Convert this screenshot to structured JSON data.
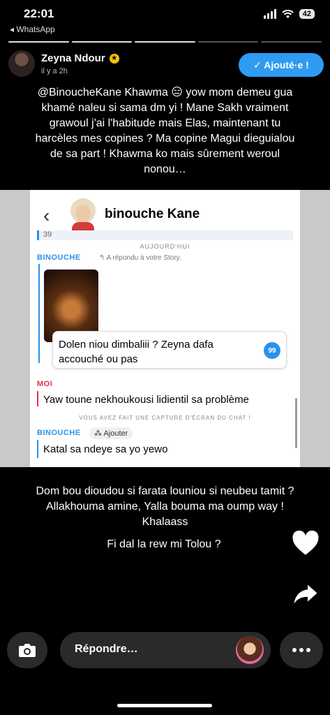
{
  "status": {
    "time": "22:01",
    "back_app": "◂ WhatsApp",
    "battery": "42"
  },
  "story": {
    "username": "Zeyna Ndour",
    "time_ago": "il y a 2h",
    "added_button": "✓ Ajouté·e !",
    "caption": "@BinoucheKane Khawma 😑 yow mom demeu gua\nkhamé naleu si sama dm yi ! Mane Sakh vraiment\ngrawoul j'ai l'habitude mais Elas, maintenant tu\nharcèles mes copines ? Ma copine Magui dieguialou\nde sa part ! Khawma ko mais sûrement weroul\nnonou…"
  },
  "chat": {
    "title": "binouche Kane",
    "prev_fragment": "39",
    "date_label": "AUJOURD'HUI",
    "sender_binouche": "BINOUCHE",
    "reply_note": "↰ A répondu à votre Story.",
    "reply_text": "Dolen niou dimbaliii ? Zeyna dafa\naccouché ou pas",
    "reply_badge": "99",
    "sender_moi": "MOI",
    "moi_text": "Yaw toune nekhoukousi lidientil sa problème",
    "capture_note": "VOUS AVEZ FAIT UNE CAPTURE D'ÉCRAN DU CHAT !",
    "sender_binouche2": "BINOUCHE",
    "add_chip": "⁂ Ajouter",
    "last_text": "Katal sa ndeye sa yo yewo"
  },
  "body": {
    "text1": "Dom bou dioudou si farata louniou si neubeu tamit ?\nAllakhouma amine, Yalla bouma ma oump way !\nKhalaass",
    "text2": "Fi dal la rew mi Tolou ?"
  },
  "bottom": {
    "reply_placeholder": "Répondre…"
  },
  "colors": {
    "accent": "#2f9bf3",
    "moi": "#e0304a",
    "binouche": "#2a92ea"
  },
  "icons": [
    "back-arrow-icon",
    "signal-icon",
    "wifi-icon",
    "battery-icon",
    "verified-icon",
    "heart-icon",
    "share-icon",
    "camera-icon",
    "more-icon"
  ]
}
